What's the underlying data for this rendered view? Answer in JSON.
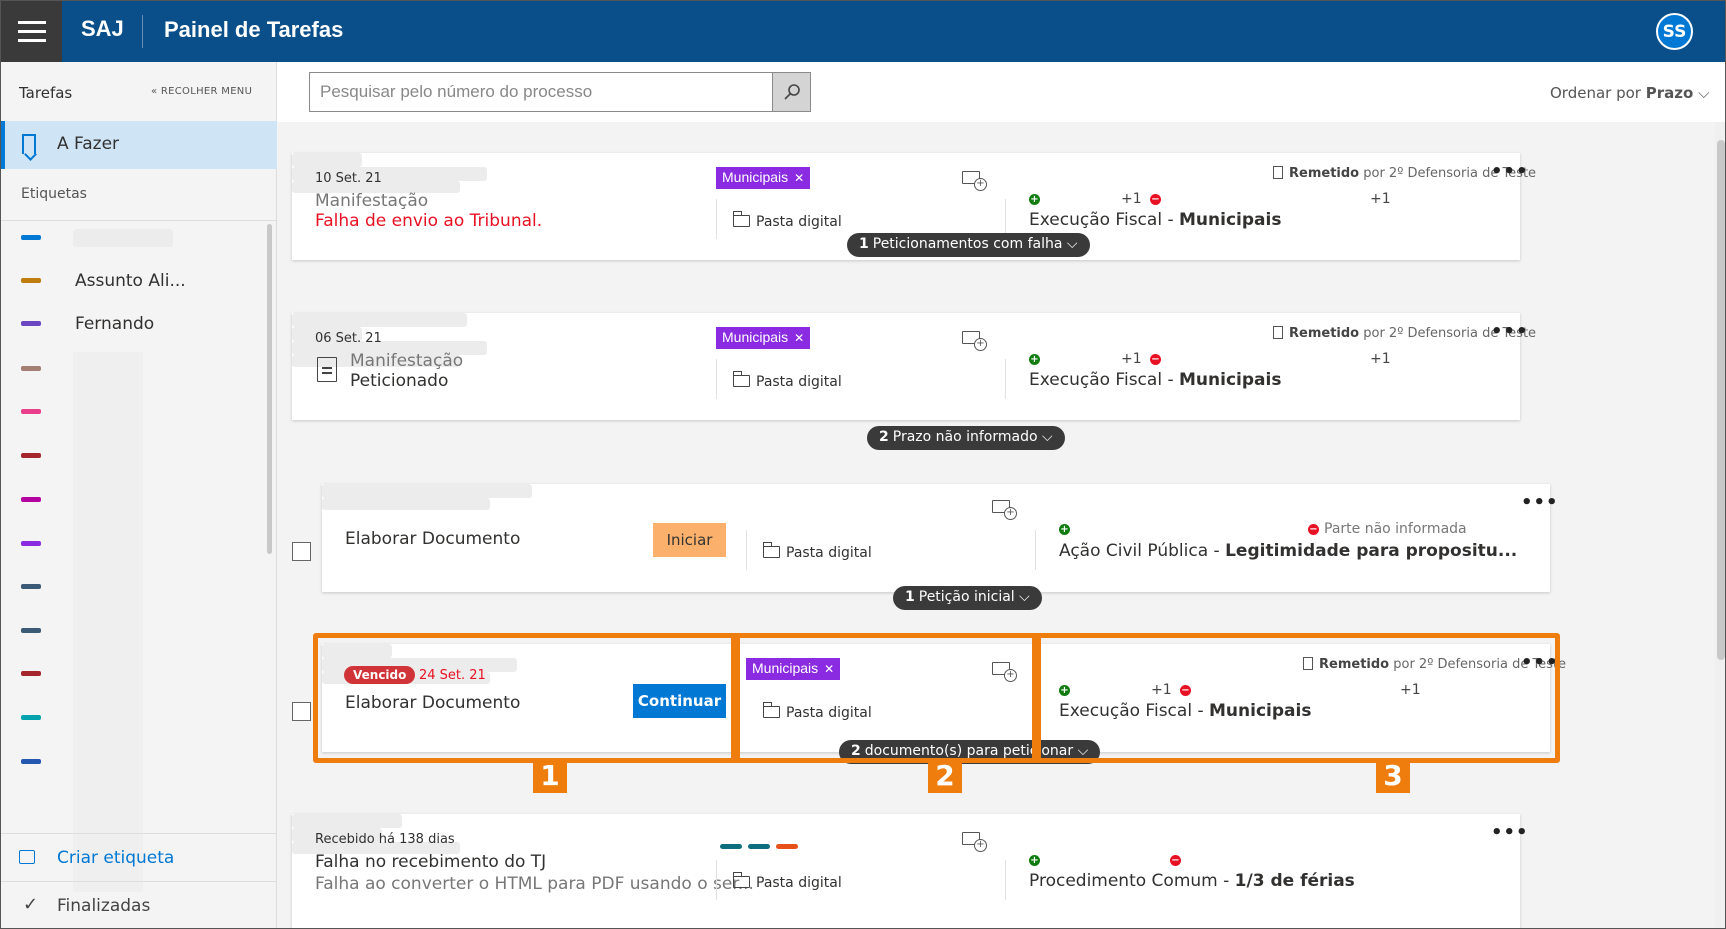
{
  "header": {
    "brand": "SAJ",
    "title": "Painel de Tarefas",
    "avatar": "SS"
  },
  "sidebar": {
    "heading": "Tarefas",
    "collapse_label": "RECOLHER MENU",
    "active_item": "A Fazer",
    "labels_heading": "Etiquetas",
    "labels": [
      {
        "text": "",
        "color": "#0078d4"
      },
      {
        "text": "Assunto Ali...",
        "color": "#c07c0c"
      },
      {
        "text": "Fernando",
        "color": "#6b46c1"
      },
      {
        "text": "",
        "color": "#a27e73"
      },
      {
        "text": "",
        "color": "#e83e8c"
      },
      {
        "text": "",
        "color": "#a4262c"
      },
      {
        "text": "",
        "color": "#b4009e"
      },
      {
        "text": "",
        "color": "#8a2be2"
      },
      {
        "text": "",
        "color": "#3b5a75"
      },
      {
        "text": "",
        "color": "#3b5a75"
      },
      {
        "text": "",
        "color": "#a4262c"
      },
      {
        "text": "",
        "color": "#00a2ad"
      },
      {
        "text": "",
        "color": "#2457b0"
      }
    ],
    "create_label": "Criar etiqueta",
    "finished_label": "Finalizadas"
  },
  "toolbar": {
    "search_placeholder": "Pesquisar pelo número do processo",
    "sort_prefix": "Ordenar por",
    "sort_value": "Prazo"
  },
  "cards": [
    {
      "date": "10 Set. 21",
      "type": "Manifestação",
      "status": "Falha de envio ao Tribunal.",
      "tag": "Municipais",
      "folder": "Pasta digital",
      "remetido": "Remetido",
      "remetido_by": "por 2º Defensoria de Teste",
      "plus_one_a": "+1",
      "plus_one_b": "+1",
      "class_name": "Execução Fiscal",
      "class_subject": "Municipais",
      "pill_count": "1",
      "pill_text": "Peticionamentos com falha"
    },
    {
      "date": "06 Set. 21",
      "type": "Manifestação",
      "status": "Peticionado",
      "tag": "Municipais",
      "folder": "Pasta digital",
      "remetido": "Remetido",
      "remetido_by": "por 2º Defensoria de Teste",
      "plus_one_a": "+1",
      "plus_one_b": "+1",
      "class_name": "Execução Fiscal",
      "class_subject": "Municipais",
      "pill_count": "2",
      "pill_text": "Prazo não informado"
    },
    {
      "title": "Elaborar Documento",
      "button": "Iniciar",
      "folder": "Pasta digital",
      "party_missing": "Parte não informada",
      "class_name": "Ação Civil Pública",
      "class_subject": "Legitimidade para propositu...",
      "pill_count": "1",
      "pill_text": "Petição inicial"
    },
    {
      "overdue": "Vencido",
      "date": "24 Set. 21",
      "title": "Elaborar Documento",
      "button": "Continuar",
      "tag": "Municipais",
      "folder": "Pasta digital",
      "remetido": "Remetido",
      "remetido_by": "por 2º Defensoria de Teste",
      "plus_one_a": "+1",
      "plus_one_b": "+1",
      "class_name": "Execução Fiscal",
      "class_subject": "Municipais",
      "pill_count": "2",
      "pill_text": "documento(s) para peticionar"
    },
    {
      "date": "Recebido há 138 dias",
      "title": "Falha no recebimento do TJ",
      "status": "Falha ao converter o HTML para PDF usando o ser...",
      "dash_colors": [
        "#0e6e7e",
        "#0e6e7e",
        "#e8501a"
      ],
      "folder": "Pasta digital",
      "class_name": "Procedimento Comum",
      "class_subject": "1/3 de férias"
    }
  ],
  "callouts": [
    "1",
    "2",
    "3"
  ],
  "colors": {
    "accent": "#0078d4",
    "header": "#0b4f8a",
    "highlight": "#ef7d0d",
    "tag": "#8a2be2"
  }
}
